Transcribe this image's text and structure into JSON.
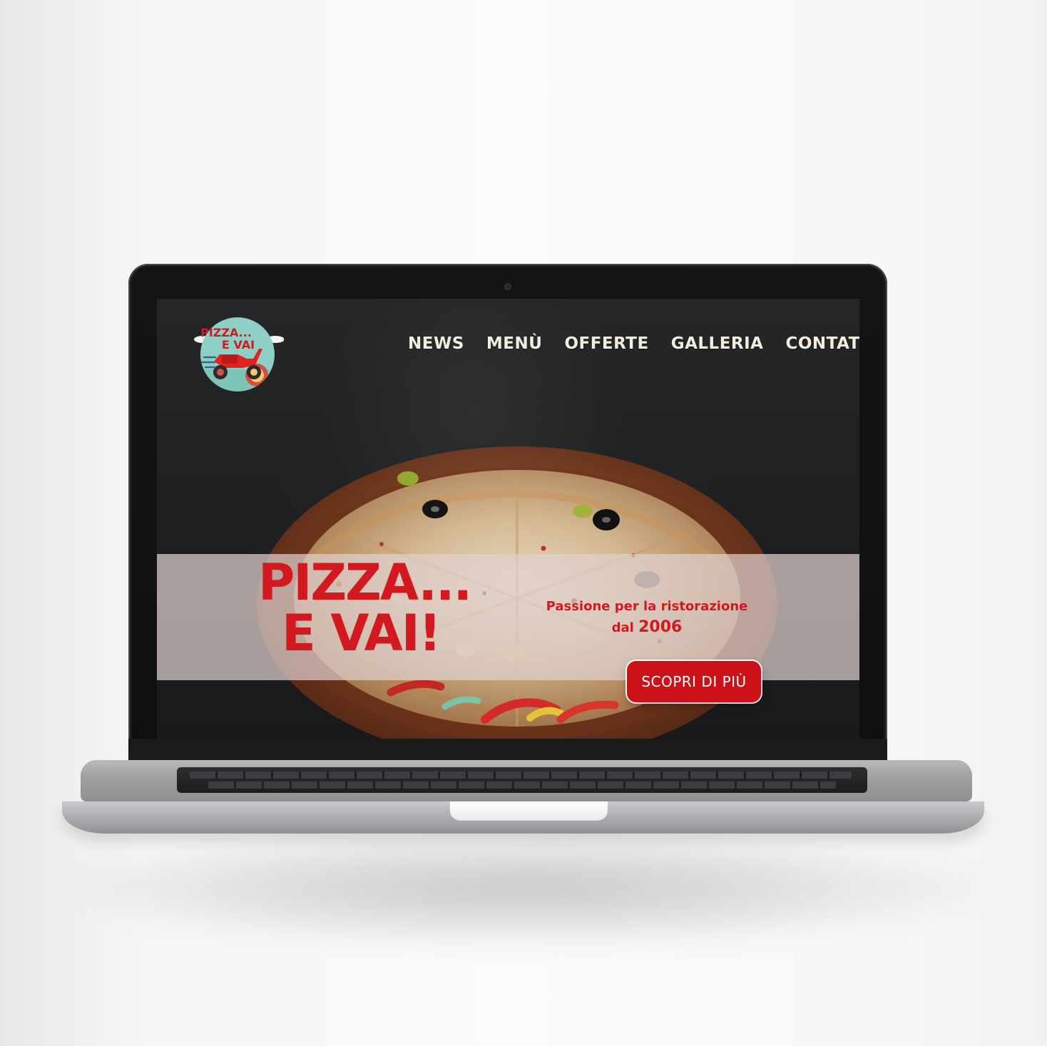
{
  "brand": {
    "logo_lines": [
      "PIZZA...",
      "E VAI"
    ]
  },
  "nav": {
    "items": [
      {
        "label": "NEWS"
      },
      {
        "label": "MENÙ"
      },
      {
        "label": "OFFERTE"
      },
      {
        "label": "GALLERIA"
      },
      {
        "label": "CONTATTI"
      }
    ]
  },
  "hero": {
    "title_line1": "PIZZA...",
    "title_line2": "E VAI!",
    "tagline_line1": "Passione per la ristorazione",
    "tagline_line2_prefix": "dal ",
    "tagline_year": "2006",
    "cta_label": "SCOPRI DI PIÙ"
  },
  "colors": {
    "accent_red": "#d31920",
    "nav_text": "#f3ecdf",
    "band_overlay": "#dfd0ce",
    "logo_teal": "#8ed0c5"
  }
}
